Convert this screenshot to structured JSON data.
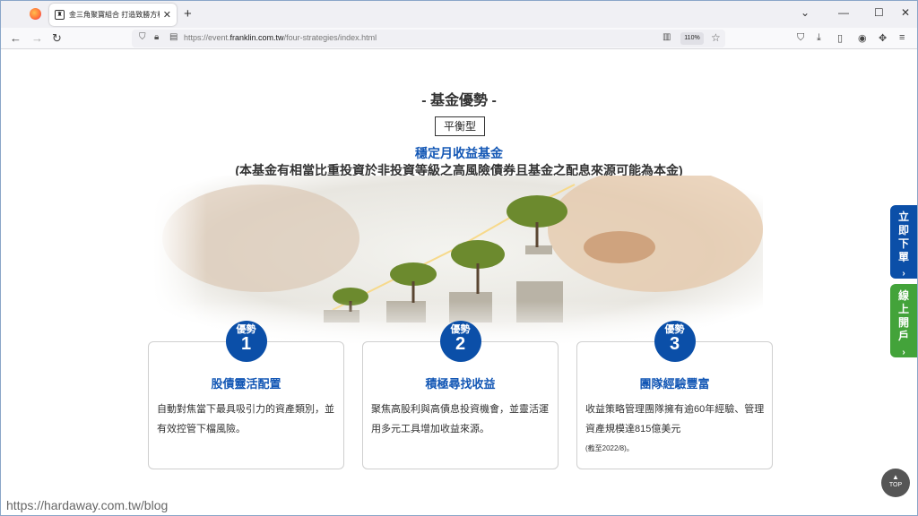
{
  "browser": {
    "tab_title": "金三角聚寶組合 打造致勝方程式",
    "url_scheme": "https://event.",
    "url_host": "franklin.com.tw",
    "url_path": "/four-strategies/index.html",
    "zoom": "110%"
  },
  "page": {
    "heading": "- 基金優勢 -",
    "type_badge": "平衡型",
    "fund_name": "穩定月收益基金",
    "fund_note": "(本基金有相當比重投資於非投資等級之高風險債券且基金之配息來源可能為本金)",
    "advantages": [
      {
        "label": "優勢",
        "num": "1",
        "title": "股債靈活配置",
        "body": "自動對焦當下最具吸引力的資產類別，並有效控管下檔風險。",
        "foot": ""
      },
      {
        "label": "優勢",
        "num": "2",
        "title": "積極尋找收益",
        "body": "聚焦高股利與高債息投資機會，並靈活運用多元工具增加收益來源。",
        "foot": ""
      },
      {
        "label": "優勢",
        "num": "3",
        "title": "團隊經驗豐富",
        "body": "收益策略管理團隊擁有逾60年經驗、管理資產規模達815億美元",
        "foot": "(截至2022/8)。"
      }
    ],
    "side_buttons": [
      {
        "label": "立即下單",
        "arrow": "›",
        "color": "#0b4fa8"
      },
      {
        "label": "線上開戶",
        "arrow": "›",
        "color": "#43a33a"
      }
    ],
    "top_button": {
      "arrow": "▲",
      "label": "TOP"
    },
    "watermark": "https://hardaway.com.tw/blog"
  }
}
